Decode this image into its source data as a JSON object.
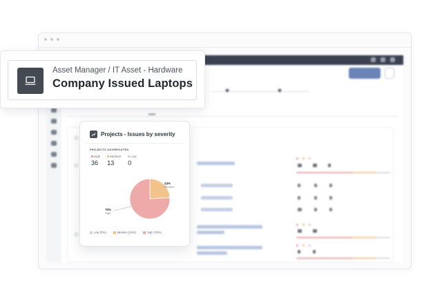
{
  "breadcrumb": {
    "path": "Asset Manager / IT Asset - Hardware",
    "title": "Company Issued Laptops",
    "icon": "laptop-icon"
  },
  "chart_card": {
    "title": "Projects - Issues by severity",
    "icon": "chart-icon",
    "aggregated_label": "PROJECTS AGGREGATED",
    "counts": [
      {
        "key": "High",
        "value": "36",
        "color": "#e7a1a1"
      },
      {
        "key": "Medium",
        "value": "13",
        "color": "#f0c088"
      },
      {
        "key": "Low",
        "value": "0",
        "color": "#cfd3d9"
      }
    ]
  },
  "chart_data": {
    "type": "pie",
    "categories": [
      "High",
      "Medium",
      "Low"
    ],
    "values": [
      76,
      24,
      0
    ],
    "slice_labels": [
      {
        "pct": "76%",
        "name": "High"
      },
      {
        "pct": "24%",
        "name": "Medium"
      }
    ],
    "legend": [
      "Low (0%)",
      "Medium (24%)",
      "High (76%)"
    ],
    "colors": [
      "#eeaaa9",
      "#f2c48b",
      "#cfd3d9"
    ],
    "legend_position": "bottom"
  },
  "colors": {
    "topbar": "#3b4150",
    "primary": "#6b84b8",
    "link": "#5b76ad",
    "tile": "#454a52"
  }
}
